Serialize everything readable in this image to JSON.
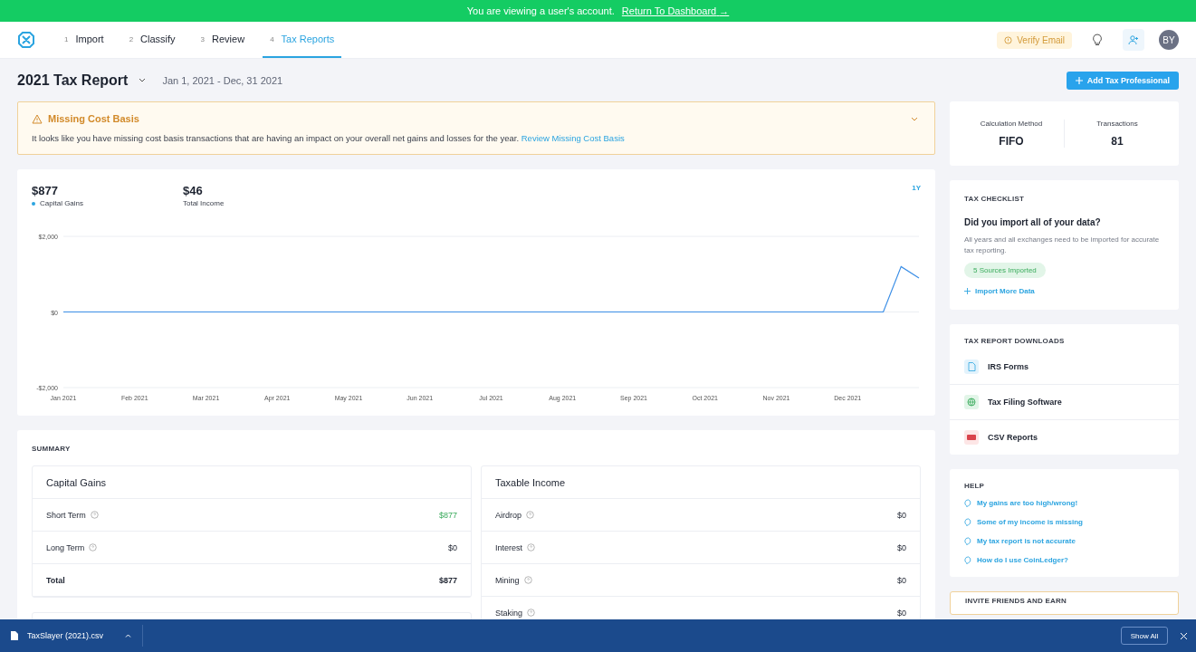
{
  "banner": {
    "text": "You are viewing a user's account.",
    "link": "Return To Dashboard",
    "arrow": "→"
  },
  "nav": {
    "tabs": [
      {
        "number": "1",
        "label": "Import",
        "selected": false
      },
      {
        "number": "2",
        "label": "Classify",
        "selected": false
      },
      {
        "number": "3",
        "label": "Review",
        "selected": false
      },
      {
        "number": "4",
        "label": "Tax Reports",
        "selected": true
      }
    ],
    "verify": "Verify Email",
    "avatar": "BY"
  },
  "header": {
    "title": "2021 Tax Report",
    "range": "Jan 1, 2021 - Dec, 31 2021",
    "button": "Add Tax Professional"
  },
  "alert": {
    "title": "Missing Cost Basis",
    "text": "It looks like you have missing cost basis transactions that are having an impact on your overall net gains and losses for the year.",
    "link": "Review Missing Cost Basis",
    "expanded": false
  },
  "chart": {
    "stats": [
      {
        "value": "$877",
        "label": "Capital Gains",
        "color": "#2ba4e0"
      },
      {
        "value": "$46",
        "label": "Total Income"
      }
    ],
    "period": "1Y",
    "chart_data": {
      "type": "line",
      "categories": [
        "Jan 2021",
        null,
        null,
        null,
        "Feb 2021",
        null,
        null,
        null,
        "Mar 2021",
        null,
        null,
        null,
        "Apr 2021",
        null,
        null,
        null,
        "May 2021",
        null,
        null,
        null,
        "Jun 2021",
        null,
        null,
        null,
        "Jul 2021",
        null,
        null,
        null,
        "Aug 2021",
        null,
        null,
        null,
        "Sep 2021",
        null,
        null,
        null,
        "Oct 2021",
        null,
        null,
        null,
        "Nov 2021",
        null,
        null,
        null,
        "Dec 2021",
        null,
        null,
        null,
        null
      ],
      "series": [
        {
          "color": "#3a8ee6",
          "values": [
            0,
            0,
            0,
            0,
            0,
            0,
            0,
            0,
            0,
            0,
            0,
            0,
            0,
            0,
            0,
            0,
            0,
            0,
            0,
            0,
            0,
            0,
            0,
            0,
            0,
            0,
            0,
            0,
            0,
            0,
            0,
            0,
            0,
            0,
            0,
            0,
            0,
            0,
            0,
            0,
            0,
            0,
            0,
            0,
            0,
            0,
            0,
            1200,
            900
          ]
        }
      ],
      "ylim": [
        -2000,
        2000
      ],
      "yticks": [
        {
          "value": 2000,
          "label": "$2,000"
        },
        {
          "value": 0,
          "label": "$0"
        },
        {
          "value": -2000,
          "label": "-$2,000"
        }
      ]
    }
  },
  "summary": {
    "title": "SUMMARY",
    "tables": [
      {
        "title": "Capital Gains",
        "rows": [
          {
            "label": "Short Term",
            "value": "$877",
            "kind": "gain",
            "info": true
          },
          {
            "label": "Long Term",
            "value": "$0",
            "kind": "plain",
            "info": true
          },
          {
            "label": "Total",
            "value": "$877",
            "kind": "total",
            "info": false
          }
        ]
      },
      {
        "title": "Taxable Income",
        "rows": [
          {
            "label": "Airdrop",
            "value": "$0",
            "kind": "plain",
            "info": true
          },
          {
            "label": "Interest",
            "value": "$0",
            "kind": "plain",
            "info": true
          },
          {
            "label": "Mining",
            "value": "$0",
            "kind": "plain",
            "info": true
          },
          {
            "label": "Staking",
            "value": "$0",
            "kind": "plain",
            "info": true
          }
        ]
      }
    ]
  },
  "stats": [
    {
      "label": "Calculation Method",
      "value": "FIFO"
    },
    {
      "label": "Transactions",
      "value": "81"
    }
  ],
  "checklist": {
    "title": "TAX CHECKLIST",
    "question": "Did you import all of your data?",
    "text": "All years and all exchanges need to be imported for accurate tax reporting.",
    "badge": "5 Sources Imported",
    "link": "Import More Data"
  },
  "downloads": {
    "title": "TAX REPORT DOWNLOADS",
    "items": [
      {
        "label": "IRS Forms",
        "kind": "document"
      },
      {
        "label": "Tax Filing Software",
        "kind": "globe"
      },
      {
        "label": "CSV Reports",
        "kind": "csv"
      }
    ]
  },
  "help": {
    "title": "HELP",
    "items": [
      "My gains are too high/wrong!",
      "Some of my income is missing",
      "My tax report is not accurate",
      "How do I use CoinLedger?"
    ]
  },
  "invite": {
    "title": "INVITE FRIENDS AND EARN"
  },
  "download_bar": {
    "file": "TaxSlayer (2021).csv",
    "button": "Show All"
  }
}
